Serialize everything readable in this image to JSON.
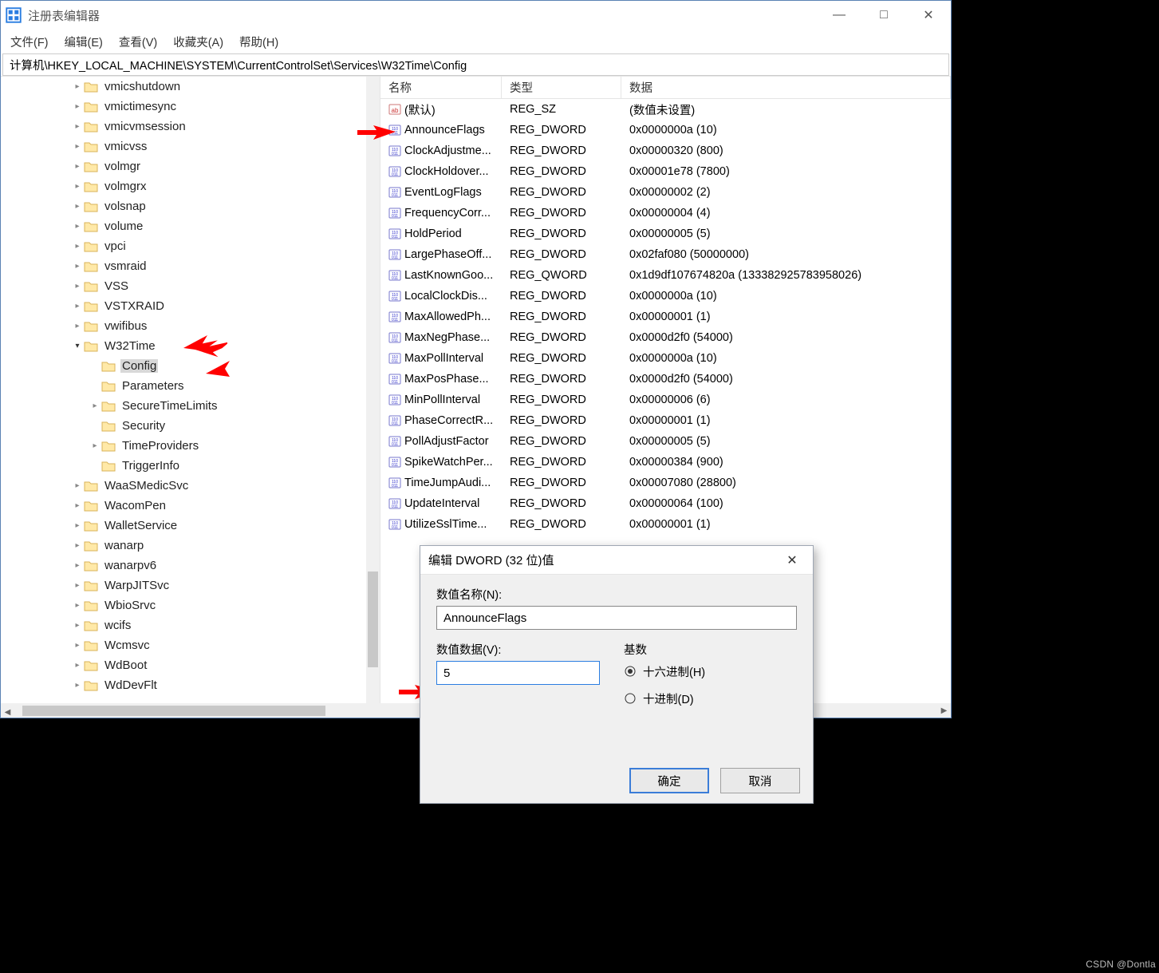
{
  "window": {
    "title": "注册表编辑器",
    "min": "—",
    "max": "□",
    "close": "✕"
  },
  "menu": {
    "file": "文件(F)",
    "edit": "编辑(E)",
    "view": "查看(V)",
    "fav": "收藏夹(A)",
    "help": "帮助(H)"
  },
  "path": "计算机\\HKEY_LOCAL_MACHINE\\SYSTEM\\CurrentControlSet\\Services\\W32Time\\Config",
  "tree": [
    {
      "indent": 4,
      "chev": ">",
      "label": "vmicshutdown"
    },
    {
      "indent": 4,
      "chev": ">",
      "label": "vmictimesync"
    },
    {
      "indent": 4,
      "chev": ">",
      "label": "vmicvmsession"
    },
    {
      "indent": 4,
      "chev": ">",
      "label": "vmicvss"
    },
    {
      "indent": 4,
      "chev": ">",
      "label": "volmgr"
    },
    {
      "indent": 4,
      "chev": ">",
      "label": "volmgrx"
    },
    {
      "indent": 4,
      "chev": ">",
      "label": "volsnap"
    },
    {
      "indent": 4,
      "chev": ">",
      "label": "volume"
    },
    {
      "indent": 4,
      "chev": ">",
      "label": "vpci"
    },
    {
      "indent": 4,
      "chev": ">",
      "label": "vsmraid"
    },
    {
      "indent": 4,
      "chev": ">",
      "label": "VSS"
    },
    {
      "indent": 4,
      "chev": ">",
      "label": "VSTXRAID"
    },
    {
      "indent": 4,
      "chev": ">",
      "label": "vwifibus"
    },
    {
      "indent": 4,
      "chev": "v",
      "label": "W32Time",
      "open": true
    },
    {
      "indent": 5,
      "chev": "",
      "label": "Config",
      "selected": true
    },
    {
      "indent": 5,
      "chev": "",
      "label": "Parameters"
    },
    {
      "indent": 5,
      "chev": ">",
      "label": "SecureTimeLimits"
    },
    {
      "indent": 5,
      "chev": "",
      "label": "Security"
    },
    {
      "indent": 5,
      "chev": ">",
      "label": "TimeProviders"
    },
    {
      "indent": 5,
      "chev": "",
      "label": "TriggerInfo"
    },
    {
      "indent": 4,
      "chev": ">",
      "label": "WaaSMedicSvc"
    },
    {
      "indent": 4,
      "chev": ">",
      "label": "WacomPen"
    },
    {
      "indent": 4,
      "chev": ">",
      "label": "WalletService"
    },
    {
      "indent": 4,
      "chev": ">",
      "label": "wanarp"
    },
    {
      "indent": 4,
      "chev": ">",
      "label": "wanarpv6"
    },
    {
      "indent": 4,
      "chev": ">",
      "label": "WarpJITSvc"
    },
    {
      "indent": 4,
      "chev": ">",
      "label": "WbioSrvc"
    },
    {
      "indent": 4,
      "chev": ">",
      "label": "wcifs"
    },
    {
      "indent": 4,
      "chev": ">",
      "label": "Wcmsvc"
    },
    {
      "indent": 4,
      "chev": ">",
      "label": "WdBoot"
    },
    {
      "indent": 4,
      "chev": ">",
      "label": "WdDevFlt"
    }
  ],
  "columns": {
    "name": "名称",
    "type": "类型",
    "data": "数据"
  },
  "values": [
    {
      "icon": "sz",
      "name": "(默认)",
      "type": "REG_SZ",
      "data": "(数值未设置)"
    },
    {
      "icon": "bin",
      "name": "AnnounceFlags",
      "type": "REG_DWORD",
      "data": "0x0000000a (10)"
    },
    {
      "icon": "bin",
      "name": "ClockAdjustme...",
      "type": "REG_DWORD",
      "data": "0x00000320 (800)"
    },
    {
      "icon": "bin",
      "name": "ClockHoldover...",
      "type": "REG_DWORD",
      "data": "0x00001e78 (7800)"
    },
    {
      "icon": "bin",
      "name": "EventLogFlags",
      "type": "REG_DWORD",
      "data": "0x00000002 (2)"
    },
    {
      "icon": "bin",
      "name": "FrequencyCorr...",
      "type": "REG_DWORD",
      "data": "0x00000004 (4)"
    },
    {
      "icon": "bin",
      "name": "HoldPeriod",
      "type": "REG_DWORD",
      "data": "0x00000005 (5)"
    },
    {
      "icon": "bin",
      "name": "LargePhaseOff...",
      "type": "REG_DWORD",
      "data": "0x02faf080 (50000000)"
    },
    {
      "icon": "bin",
      "name": "LastKnownGoo...",
      "type": "REG_QWORD",
      "data": "0x1d9df107674820a (133382925783958026)"
    },
    {
      "icon": "bin",
      "name": "LocalClockDis...",
      "type": "REG_DWORD",
      "data": "0x0000000a (10)"
    },
    {
      "icon": "bin",
      "name": "MaxAllowedPh...",
      "type": "REG_DWORD",
      "data": "0x00000001 (1)"
    },
    {
      "icon": "bin",
      "name": "MaxNegPhase...",
      "type": "REG_DWORD",
      "data": "0x0000d2f0 (54000)"
    },
    {
      "icon": "bin",
      "name": "MaxPollInterval",
      "type": "REG_DWORD",
      "data": "0x0000000a (10)"
    },
    {
      "icon": "bin",
      "name": "MaxPosPhase...",
      "type": "REG_DWORD",
      "data": "0x0000d2f0 (54000)"
    },
    {
      "icon": "bin",
      "name": "MinPollInterval",
      "type": "REG_DWORD",
      "data": "0x00000006 (6)"
    },
    {
      "icon": "bin",
      "name": "PhaseCorrectR...",
      "type": "REG_DWORD",
      "data": "0x00000001 (1)"
    },
    {
      "icon": "bin",
      "name": "PollAdjustFactor",
      "type": "REG_DWORD",
      "data": "0x00000005 (5)"
    },
    {
      "icon": "bin",
      "name": "SpikeWatchPer...",
      "type": "REG_DWORD",
      "data": "0x00000384 (900)"
    },
    {
      "icon": "bin",
      "name": "TimeJumpAudi...",
      "type": "REG_DWORD",
      "data": "0x00007080 (28800)"
    },
    {
      "icon": "bin",
      "name": "UpdateInterval",
      "type": "REG_DWORD",
      "data": "0x00000064 (100)"
    },
    {
      "icon": "bin",
      "name": "UtilizeSslTime...",
      "type": "REG_DWORD",
      "data": "0x00000001 (1)"
    }
  ],
  "dialog": {
    "title": "编辑 DWORD (32 位)值",
    "name_label": "数值名称(N):",
    "name_value": "AnnounceFlags",
    "data_label": "数值数据(V):",
    "data_value": "5",
    "base_label": "基数",
    "hex": "十六进制(H)",
    "dec": "十进制(D)",
    "ok": "确定",
    "cancel": "取消"
  },
  "watermark": "CSDN @Dontla"
}
